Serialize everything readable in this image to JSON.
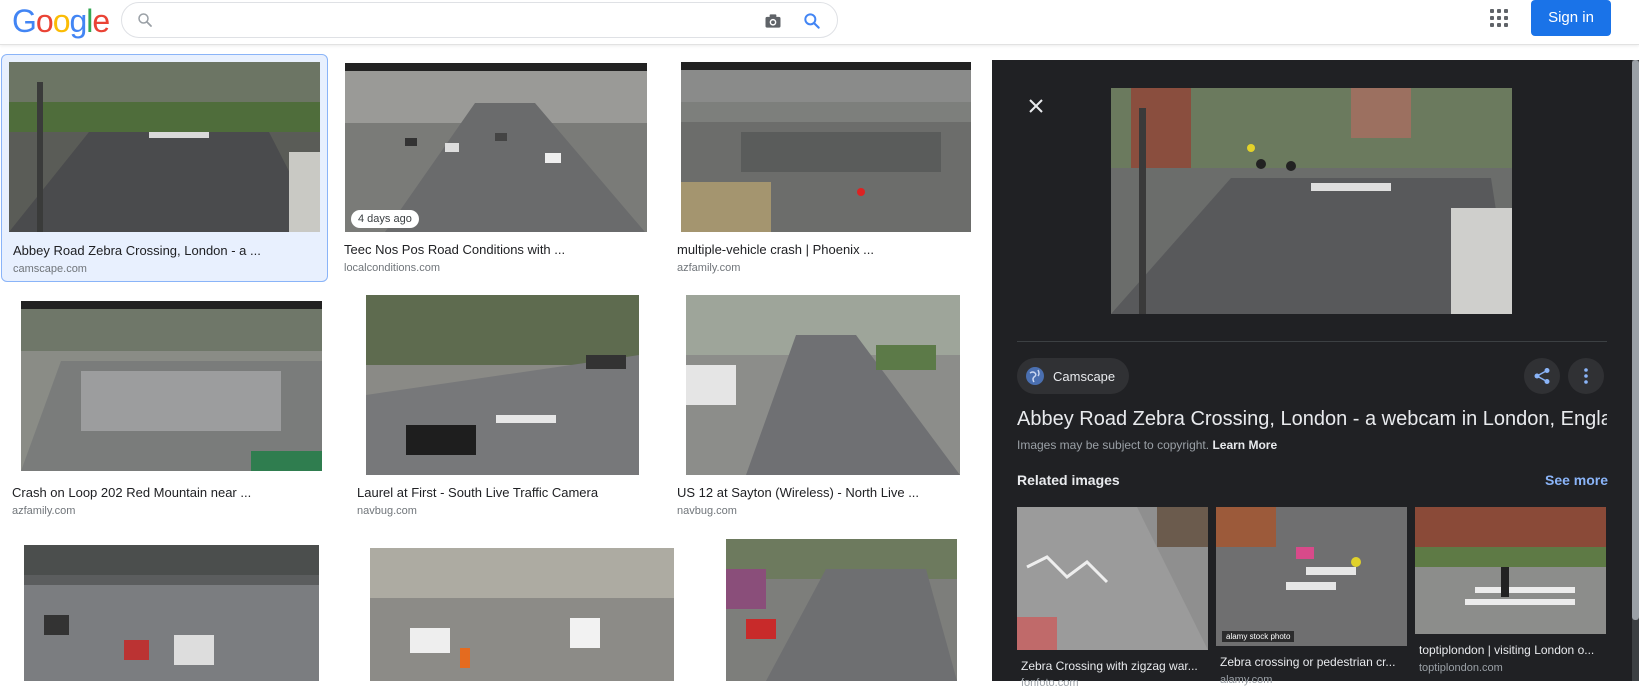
{
  "header": {
    "logo_letters": [
      {
        "ch": "G",
        "color": "#4285f4"
      },
      {
        "ch": "o",
        "color": "#ea4335"
      },
      {
        "ch": "o",
        "color": "#fbbc05"
      },
      {
        "ch": "g",
        "color": "#4285f4"
      },
      {
        "ch": "l",
        "color": "#34a853"
      },
      {
        "ch": "e",
        "color": "#ea4335"
      }
    ],
    "search_value": "",
    "signin_label": "Sign in"
  },
  "results": [
    {
      "title": "Abbey Road Zebra Crossing, London - a ...",
      "source": "camscape.com",
      "selected": true
    },
    {
      "title": "Teec Nos Pos Road Conditions with ...",
      "source": "localconditions.com",
      "badge": "4 days ago"
    },
    {
      "title": "multiple-vehicle crash | Phoenix ...",
      "source": "azfamily.com"
    },
    {
      "title": "Crash on Loop 202 Red Mountain near ...",
      "source": "azfamily.com"
    },
    {
      "title": "Laurel at First - South Live Traffic Camera",
      "source": "navbug.com"
    },
    {
      "title": "US 12 at Sayton (Wireless) - North Live ...",
      "source": "navbug.com"
    },
    {
      "title": "",
      "source": ""
    },
    {
      "title": "",
      "source": ""
    },
    {
      "title": "",
      "source": ""
    }
  ],
  "panel": {
    "source_name": "Camscape",
    "title": "Abbey Road Zebra Crossing, London - a webcam in London, Engla",
    "copyright_text": "Images may be subject to copyright.",
    "learn_more": "Learn More",
    "related_heading": "Related images",
    "see_more": "See more",
    "related": [
      {
        "title": "Zebra Crossing with zigzag war...",
        "source": "fonfoto.com"
      },
      {
        "title": "Zebra crossing or pedestrian cr...",
        "source": "alamy.com",
        "badge": "alamy stock photo"
      },
      {
        "title": "toptiplondon | visiting London o...",
        "source": "toptiplondon.com"
      }
    ]
  }
}
